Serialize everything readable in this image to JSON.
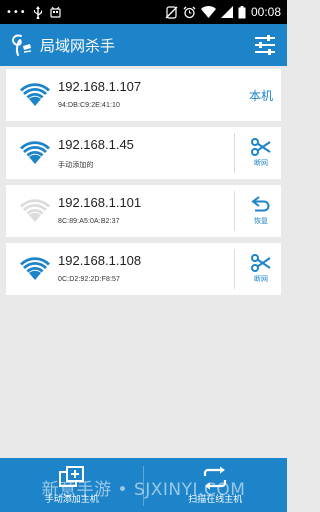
{
  "status_bar": {
    "dots": "•••",
    "time": "00:08",
    "icons": [
      "more-dots-icon",
      "usb-icon",
      "android-icon",
      "mute-icon",
      "alarm-icon",
      "wifi-signal-icon",
      "cell-signal-icon",
      "battery-icon"
    ]
  },
  "app_bar": {
    "title": "局域网杀手",
    "logo_icon": "phone-swirl-logo-icon",
    "settings_icon": "sliders-settings-icon"
  },
  "colors": {
    "accent": "#1d84c9",
    "inactive_wifi": "#dcdcdc"
  },
  "hosts": [
    {
      "ip": "192.168.1.107",
      "sub": "94:DB:C9:2E:41:10",
      "active": true,
      "action_type": "text",
      "action_label": "本机"
    },
    {
      "ip": "192.168.1.45",
      "sub": "手动添加的",
      "active": true,
      "action_type": "cut",
      "action_label": "断网"
    },
    {
      "ip": "192.168.1.101",
      "sub": "8C:89:A5:0A:B2:37",
      "active": false,
      "action_type": "restore",
      "action_label": "恢复"
    },
    {
      "ip": "192.168.1.108",
      "sub": "0C:D2:92:2D:F8:57",
      "active": true,
      "action_type": "cut",
      "action_label": "断网"
    }
  ],
  "bottom_bar": {
    "add_label": "手动添加主机",
    "scan_label": "扫描在线主机"
  },
  "watermark": "新意手游 • SJXINYI.COM"
}
